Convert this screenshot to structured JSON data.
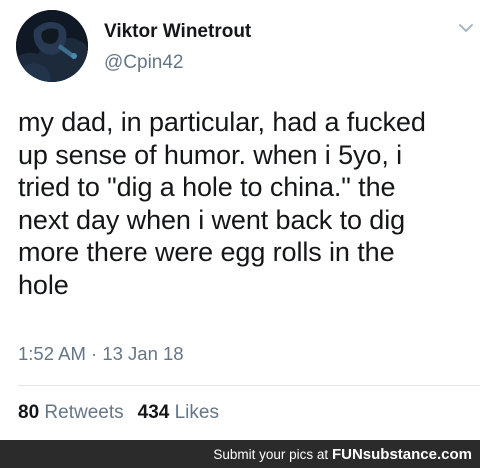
{
  "tweet": {
    "display_name": "Viktor Winetrout",
    "handle": "@Cpin42",
    "avatar_icon": "profile-avatar",
    "menu_icon": "chevron-down-icon",
    "text_lines": [
      "my dad, in particular, had a fucked",
      "up sense of humor. when i 5yo, i",
      "tried to \"dig a hole to china.\" the",
      "next day when i went back to dig",
      "more there were egg rolls in the",
      "hole"
    ],
    "timestamp": "1:52 AM · 13 Jan 18",
    "retweets_count": "80",
    "retweets_label": "Retweets",
    "likes_count": "434",
    "likes_label": "Likes"
  },
  "footer": {
    "text": "Submit your pics at",
    "brand_fun": "FUN",
    "brand_sub": "substance",
    "brand_com": ".com"
  },
  "colors": {
    "text_primary": "#14171a",
    "text_secondary": "#657786",
    "divider": "#e1e8ed",
    "footer_bg": "#2b2b2b"
  }
}
